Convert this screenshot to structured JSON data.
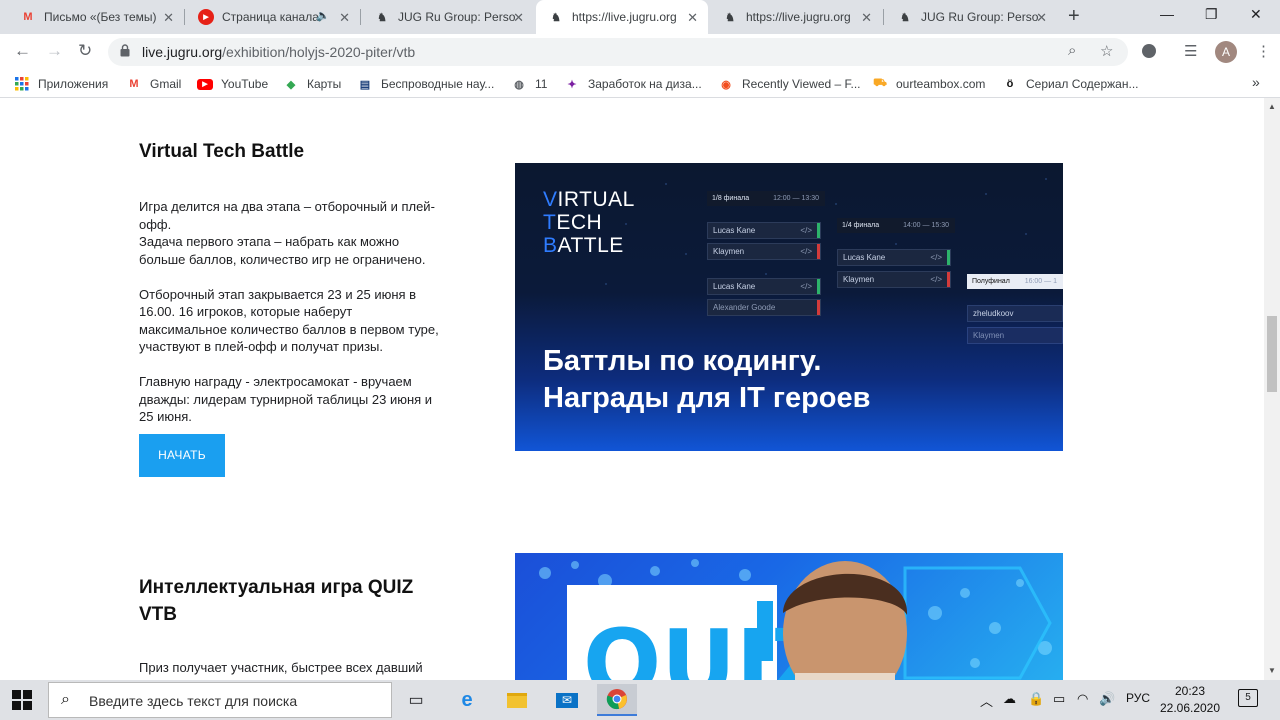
{
  "tabs": [
    {
      "title": "Письмо «(Без темы)",
      "icon": "gmail-icon",
      "glyph": "M",
      "color": "#ea4335"
    },
    {
      "title": "Страница канала",
      "icon": "youtube-icon",
      "glyph": "▶",
      "color": "#ff0000"
    },
    {
      "title": "JUG Ru Group: Perso",
      "icon": "jugru-icon",
      "glyph": "♞",
      "color": "#333333"
    },
    {
      "title": "https://live.jugru.org",
      "icon": "jugru-icon",
      "glyph": "♞",
      "color": "#333333"
    },
    {
      "title": "https://live.jugru.org",
      "icon": "jugru-icon",
      "glyph": "♞",
      "color": "#333333"
    },
    {
      "title": "JUG Ru Group: Perso",
      "icon": "jugru-icon",
      "glyph": "♞",
      "color": "#333333"
    }
  ],
  "address": {
    "domain": "live.jugru.org",
    "path": "/exhibition/holyjs-2020-piter/vtb"
  },
  "profile": {
    "initial": "A"
  },
  "bookmarks": [
    {
      "label": "Приложения",
      "icon": "apps-grid-icon",
      "glyph": "⠿",
      "color": "#1a73e8"
    },
    {
      "label": "Gmail",
      "icon": "gmail-icon",
      "glyph": "M",
      "color": "#ea4335"
    },
    {
      "label": "YouTube",
      "icon": "youtube-icon",
      "glyph": "▶",
      "color": "#ff0000"
    },
    {
      "label": "Карты",
      "icon": "maps-icon",
      "glyph": "◆",
      "color": "#34a853"
    },
    {
      "label": "Беспроводные нау...",
      "icon": "page-icon",
      "glyph": "▤",
      "color": "#1a3e7a"
    },
    {
      "label": "11",
      "icon": "globe-icon",
      "glyph": "◍",
      "color": "#5f6368"
    },
    {
      "label": "Заработок на диза...",
      "icon": "bookmark-site-icon",
      "glyph": "✦",
      "color": "#7b1fa2"
    },
    {
      "label": "Recently Viewed – F...",
      "icon": "figma-icon",
      "glyph": "◉",
      "color": "#f24e1e"
    },
    {
      "label": "ourteambox.com",
      "icon": "cart-icon",
      "glyph": "🛒",
      "color": "#f9a825"
    },
    {
      "label": "Сериал Содержан...",
      "icon": "series-icon",
      "glyph": "ö",
      "color": "#111111"
    }
  ],
  "section1": {
    "title": "Virtual Tech Battle",
    "paragraphs": [
      "Игра делится на два этапа – отборочный и плей-офф.\nЗадача первого этапа – набрать как можно больше баллов, количество игр не ограничено.",
      "Отборочный этап закрывается 23 и 25 июня в 16.00. 16 игроков, которые наберут максимальное количество баллов в первом туре, участвуют в плей-офф и получат призы.",
      "Главную награду - электросамокат - вручаем дважды: лидерам турнирной таблицы 23 июня и 25 июня."
    ],
    "button": "НАЧАТЬ"
  },
  "banner": {
    "logo_lines": [
      "IRTUAL",
      "ECH",
      "ATTLE"
    ],
    "logo_initials": [
      "V",
      "T",
      "B"
    ],
    "headline_1": "Баттлы по кодингу.",
    "headline_2": "Награды для IT героев",
    "round1": {
      "label": "1/8 финала",
      "time": "12:00 — 13:30"
    },
    "round2": {
      "label": "1/4 финала",
      "time": "14:00 — 15:30"
    },
    "round3": {
      "label": "Полуфинал",
      "time": "16:00 — 1"
    },
    "code_glyph": "</>",
    "players_r1": [
      "Lucas Kane",
      "Klaymen",
      "Lucas Kane",
      "Alexander Goode"
    ],
    "players_r2": [
      "Lucas Kane",
      "Klaymen"
    ],
    "players_r3": [
      "zheludkoov",
      "Klaymen"
    ]
  },
  "section2": {
    "title_1": "Интеллектуальная игра QUIZ",
    "title_2": "VTB",
    "text": "Приз получает участник, быстрее всех давший"
  },
  "taskbar": {
    "search_placeholder": "Введите здесь текст для поиска",
    "lang": "РУС",
    "time": "20:23",
    "date": "22.06.2020",
    "notifications": "5"
  }
}
